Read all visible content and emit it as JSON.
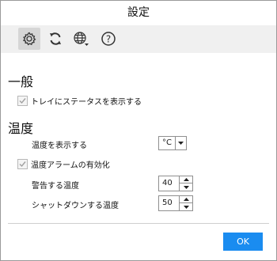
{
  "window": {
    "title": "設定"
  },
  "toolbar": {
    "items": [
      {
        "icon": "gear-icon",
        "active": true
      },
      {
        "icon": "refresh-icon",
        "active": false
      },
      {
        "icon": "globe-icon",
        "active": false
      },
      {
        "icon": "help-icon",
        "active": false
      }
    ]
  },
  "general": {
    "title": "一般",
    "show_status_in_tray": {
      "label": "トレイにステータスを表示する",
      "checked": true
    }
  },
  "temperature": {
    "title": "温度",
    "display_label": "温度を表示する",
    "unit_value": "°C",
    "alarm": {
      "label": "温度アラームの有効化",
      "checked": true
    },
    "warning_label": "警告する温度",
    "warning_value": "40",
    "shutdown_label": "シャットダウンする温度",
    "shutdown_value": "50"
  },
  "footer": {
    "ok_label": "OK"
  },
  "colors": {
    "accent": "#1a8cf0"
  }
}
